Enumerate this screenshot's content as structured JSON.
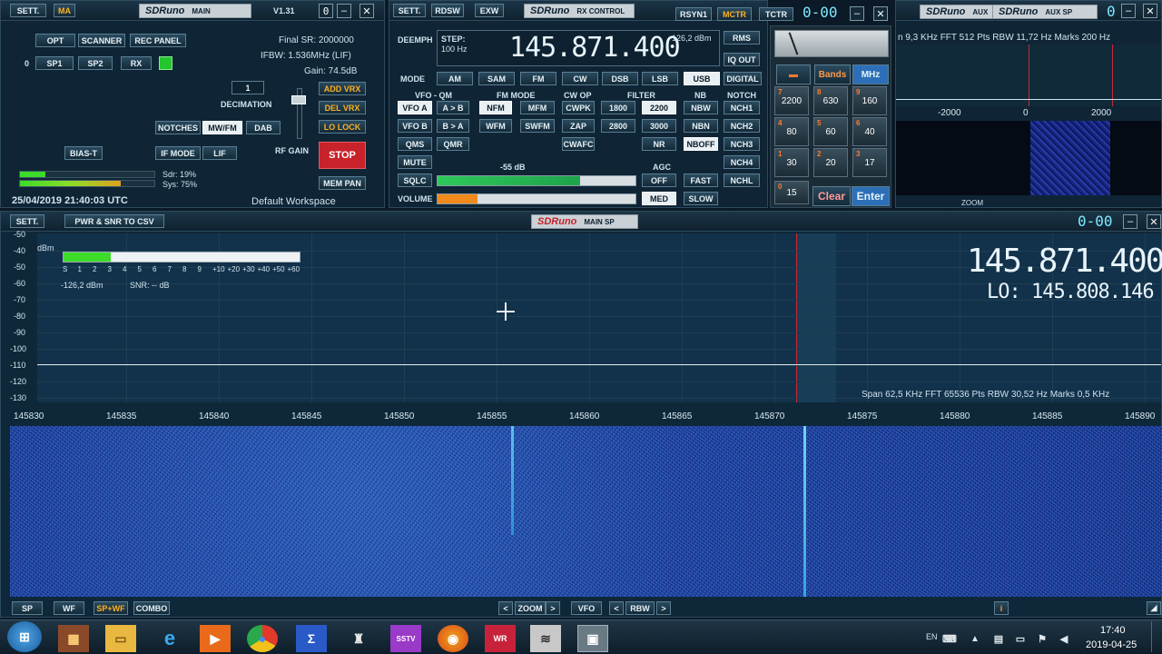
{
  "main_panel": {
    "sett": "SETT.",
    "ma": "MA",
    "logo": "SDRuno",
    "title": "MAIN",
    "version": "V1.31",
    "opt": "OPT",
    "scanner": "SCANNER",
    "rec_panel": "REC PANEL",
    "zero": "0",
    "sp1": "SP1",
    "sp2": "SP2",
    "rx": "RX",
    "final_sr": "Final SR: 2000000",
    "ifbw": "IFBW: 1.536MHz (LIF)",
    "gain": "Gain: 74.5dB",
    "decimation_value": "1",
    "decimation": "DECIMATION",
    "add_vrx": "ADD VRX",
    "del_vrx": "DEL VRX",
    "lo_lock": "LO LOCK",
    "notches": "NOTCHES",
    "mw_fm": "MW/FM",
    "dab": "DAB",
    "if_mode": "IF MODE",
    "lif": "LIF",
    "rf_gain": "RF GAIN",
    "stop": "STOP",
    "bias_t": "BIAS-T",
    "sdr": "Sdr: 19%",
    "sys": "Sys: 75%",
    "mem_pan": "MEM PAN",
    "datetime": "25/04/2019 21:40:03 UTC",
    "workspace": "Default Workspace",
    "cpu_sdr": 0.19,
    "cpu_sys": 0.75
  },
  "rx_panel": {
    "sett": "SETT.",
    "rdsw": "RDSW",
    "exw": "EXW",
    "logo": "SDRuno",
    "title": "RX CONTROL",
    "rsyn1": "RSYN1",
    "mctr": "MCTR",
    "tctr": "TCTR",
    "vrx_id": "0-00",
    "deemph": "DEEMPH",
    "step_label": "STEP:",
    "step_value": "100 Hz",
    "frequency": "145.871.400",
    "level": "-126,2 dBm",
    "rms": "RMS",
    "iq_out": "IQ OUT",
    "digital": "DIGITAL",
    "mode": "MODE",
    "modes": [
      "AM",
      "SAM",
      "FM",
      "CW",
      "DSB",
      "LSB",
      "USB"
    ],
    "vfo_qm": "VFO - QM",
    "fm_mode": "FM MODE",
    "cw_op": "CW OP",
    "filter": "FILTER",
    "nb": "NB",
    "notch": "NOTCH",
    "vfo_a": "VFO A",
    "a_to_b": "A > B",
    "nfm": "NFM",
    "mfm": "MFM",
    "cwpk": "CWPK",
    "f1800": "1800",
    "f2200": "2200",
    "nbw": "NBW",
    "nch1": "NCH1",
    "vfo_b": "VFO B",
    "b_to_a": "B > A",
    "wfm": "WFM",
    "swfm": "SWFM",
    "zap": "ZAP",
    "f2800": "2800",
    "f3000": "3000",
    "nbn": "NBN",
    "nch2": "NCH2",
    "qms": "QMS",
    "qmr": "QMR",
    "cwafc": "CWAFC",
    "nr": "NR",
    "nboff": "NBOFF",
    "nch3": "NCH3",
    "mute": "MUTE",
    "sql_db": "-55 dB",
    "agc": "AGC",
    "nch4": "NCH4",
    "sqlc": "SQLC",
    "agc_off": "OFF",
    "agc_fast": "FAST",
    "nchl": "NCHL",
    "volume": "VOLUME",
    "agc_med": "MED",
    "agc_slow": "SLOW",
    "sql_level": 0.72,
    "volume_level": 0.2
  },
  "keypad": {
    "bands": "Bands",
    "mhz": "MHz",
    "keys": [
      {
        "n": "7",
        "v": "2200"
      },
      {
        "n": "8",
        "v": "630"
      },
      {
        "n": "9",
        "v": "160"
      },
      {
        "n": "4",
        "v": "80"
      },
      {
        "n": "5",
        "v": "60"
      },
      {
        "n": "6",
        "v": "40"
      },
      {
        "n": "1",
        "v": "30"
      },
      {
        "n": "2",
        "v": "20"
      },
      {
        "n": "3",
        "v": "17"
      }
    ],
    "zero_n": "0",
    "zero_v": "15",
    "clear": "Clear",
    "enter": "Enter"
  },
  "aux_panel": {
    "logo1": "SDRuno",
    "aux": "AUX",
    "logo2": "SDRuno",
    "title": "AUX SP",
    "info": "n 9,3 KHz  FFT 512 Pts  RBW 11,72 Hz  Marks 200 Hz",
    "ticks": [
      "-2000",
      "0",
      "2000"
    ],
    "zoom": "ZOOM"
  },
  "main_sp": {
    "sett": "SETT.",
    "csv": "PWR & SNR TO CSV",
    "logo": "SDRuno",
    "title": "MAIN SP",
    "vrx_id": "0-00",
    "dbm": "dBm",
    "y_ticks": [
      "-50",
      "-40",
      "-50",
      "-60",
      "-70",
      "-80",
      "-90",
      "-100",
      "-110",
      "-120",
      "-130"
    ],
    "smeter": [
      "S",
      "1",
      "2",
      "3",
      "4",
      "5",
      "6",
      "7",
      "8",
      "9",
      "+10",
      "+20",
      "+30",
      "+40",
      "+50",
      "+60"
    ],
    "smeter_level": 0.2,
    "level": "-126,2 dBm",
    "snr": "SNR: -- dB",
    "frequency": "145.871.400",
    "lo": "LO: 145.808.146",
    "info": "Span 62,5 KHz  FFT 65536 Pts  RBW 30,52 Hz  Marks 0,5 KHz",
    "x_ticks": [
      "145830",
      "145835",
      "145840",
      "145845",
      "145850",
      "145855",
      "145860",
      "145865",
      "145870",
      "145875",
      "145880",
      "145885",
      "145890"
    ],
    "sp": "SP",
    "wf": "WF",
    "spwf": "SP+WF",
    "combo": "COMBO",
    "zoom": "ZOOM",
    "vfo": "VFO",
    "rbw": "RBW"
  },
  "taskbar": {
    "lang": "EN",
    "time": "17:40",
    "date": "2019-04-25"
  }
}
